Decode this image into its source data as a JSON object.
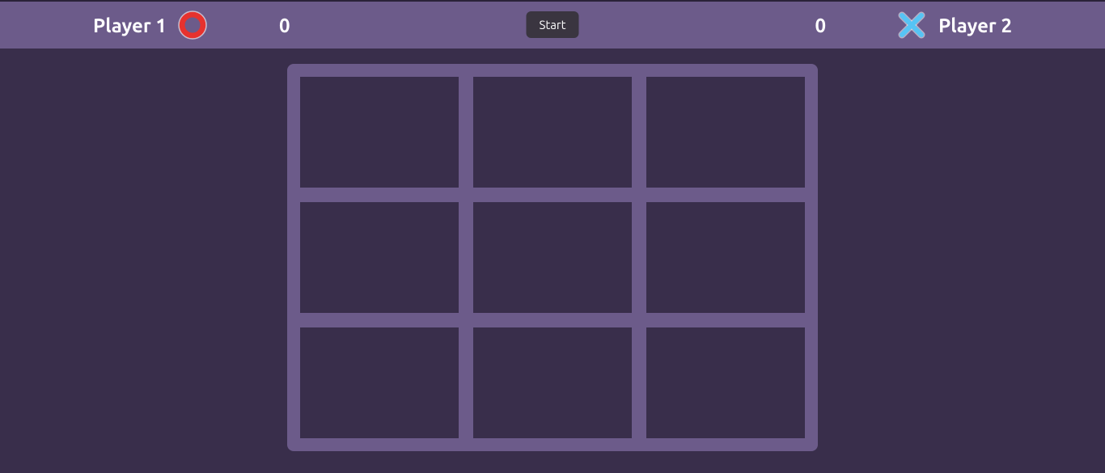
{
  "header": {
    "player1_label": "Player 1",
    "player2_label": "Player 2",
    "player1_score": "0",
    "player2_score": "0",
    "start_button_label": "Start",
    "player1_symbol": "circle",
    "player2_symbol": "x"
  },
  "colors": {
    "background": "#392e4b",
    "header_bg": "#6c5b8a",
    "board_bg": "#6c5b8a",
    "cell_bg": "#392e4b",
    "circle_color": "#e6322e",
    "x_color": "#56c4f5",
    "text_color": "#ffffff"
  },
  "board": {
    "cells": [
      "",
      "",
      "",
      "",
      "",
      "",
      "",
      "",
      ""
    ]
  }
}
